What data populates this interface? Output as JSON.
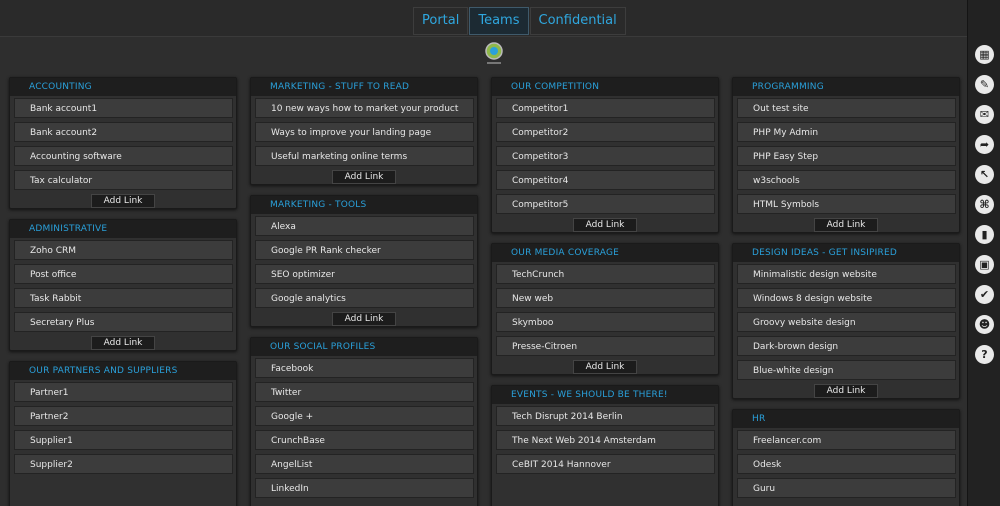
{
  "tabs": [
    "Portal",
    "Teams",
    "Confidential"
  ],
  "active_tab": "Teams",
  "columns": [
    [
      {
        "title": "ACCOUNTING",
        "items": [
          "Bank account1",
          "Bank account2",
          "Accounting software",
          "Tax calculator"
        ],
        "add": "Add Link"
      },
      {
        "title": "ADMINISTRATIVE",
        "items": [
          "Zoho CRM",
          "Post office",
          "Task Rabbit",
          "Secretary Plus"
        ],
        "add": "Add Link"
      },
      {
        "title": "OUR PARTNERS AND SUPPLIERS",
        "items": [
          "Partner1",
          "Partner2",
          "Supplier1",
          "Supplier2"
        ],
        "add": ""
      }
    ],
    [
      {
        "title": "MARKETING - STUFF TO READ",
        "items": [
          "10 new ways how to market your product",
          "Ways to improve your landing page",
          "Useful marketing online terms"
        ],
        "add": "Add Link"
      },
      {
        "title": "MARKETING - TOOLS",
        "items": [
          "Alexa",
          "Google PR Rank checker",
          "SEO optimizer",
          "Google analytics"
        ],
        "add": "Add Link"
      },
      {
        "title": "OUR SOCIAL PROFILES",
        "items": [
          "Facebook",
          "Twitter",
          "Google +",
          "CrunchBase",
          "AngelList",
          "LinkedIn"
        ],
        "add": ""
      }
    ],
    [
      {
        "title": "OUR COMPETITION",
        "items": [
          "Competitor1",
          "Competitor2",
          "Competitor3",
          "Competitor4",
          "Competitor5"
        ],
        "add": "Add Link"
      },
      {
        "title": "OUR MEDIA COVERAGE",
        "items": [
          "TechCrunch",
          "New web",
          "Skymboo",
          "Presse-Citroen"
        ],
        "add": "Add Link"
      },
      {
        "title": "EVENTS - WE SHOULD BE THERE!",
        "items": [
          "Tech Disrupt 2014 Berlin",
          "The Next Web 2014 Amsterdam",
          "CeBIT 2014 Hannover"
        ],
        "add": ""
      }
    ],
    [
      {
        "title": "PROGRAMMING",
        "items": [
          "Out test site",
          "PHP My Admin",
          "PHP Easy Step",
          "w3schools",
          "HTML Symbols"
        ],
        "add": "Add Link"
      },
      {
        "title": "DESIGN IDEAS - GET INSIPIRED",
        "items": [
          "Minimalistic design website",
          "Windows 8 design website",
          "Groovy website design",
          "Dark-brown design",
          "Blue-white design"
        ],
        "add": "Add Link"
      },
      {
        "title": "HR",
        "items": [
          "Freelancer.com",
          "Odesk",
          "Guru"
        ],
        "add": ""
      }
    ]
  ],
  "right_icons": [
    "grid-icon",
    "edit-icon",
    "mail-icon",
    "share-icon",
    "cursor-icon",
    "network-icon",
    "chart-icon",
    "box-icon",
    "check-icon",
    "user-icon",
    "help-icon"
  ],
  "help_glyph": "?"
}
